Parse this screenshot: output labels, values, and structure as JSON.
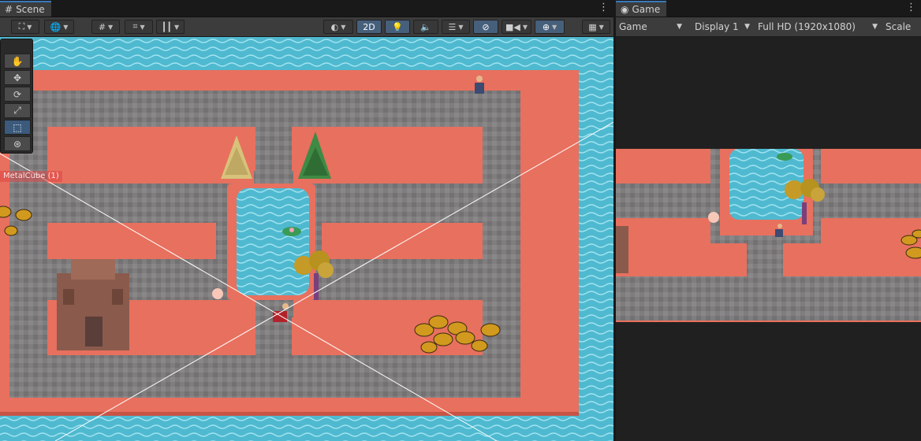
{
  "scene": {
    "tab_label": "Scene",
    "tab_icon": "scene-grid-icon",
    "toolbar": {
      "view_2d_label": "2D",
      "buttons": [
        "gizmo-toggle-icon",
        "globe-icon",
        "snap-grid-icon",
        "increment-snap-icon",
        "ruler-icon",
        "draw-mode-icon",
        "2d-mode",
        "light-icon",
        "audio-icon",
        "effects-icon",
        "hidden-objects-icon",
        "camera-icon",
        "gizmos-icon",
        "overlay-icon"
      ]
    },
    "object_label": "MetalCube (1)",
    "tools": [
      "hand-tool",
      "move-tool",
      "rotate-tool",
      "scale-tool",
      "rect-tool",
      "transform-tool"
    ]
  },
  "game": {
    "tab_label": "Game",
    "tab_icon": "gamepad-icon",
    "display_mode": "Game",
    "display": "Display 1",
    "resolution": "Full HD (1920x1080)",
    "scale_label": "Scale"
  },
  "colors": {
    "ground": "#e8705e",
    "stone": "#7d7b7b",
    "water": "#4fb9d0",
    "editor_bg": "#282828",
    "accent": "#3a79bb"
  }
}
